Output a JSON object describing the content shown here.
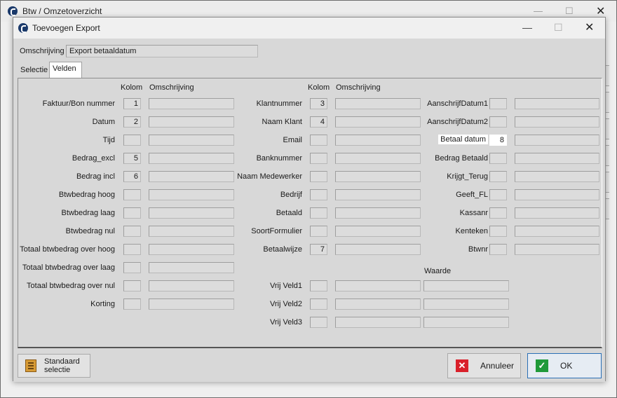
{
  "main_window": {
    "title": "Btw / Omzetoverzicht"
  },
  "dialog": {
    "title": "Toevoegen Export",
    "omschrijving_label": "Omschrijving",
    "omschrijving_value": "Export betaaldatum",
    "tabs": [
      {
        "label": "Selectie"
      },
      {
        "label": "Velden"
      }
    ],
    "col1": {
      "kolom_header": "Kolom",
      "omschrijving_header": "Omschrijving",
      "rows": [
        {
          "label": "Faktuur/Bon nummer",
          "kolom": "1",
          "omschrijving": ""
        },
        {
          "label": "Datum",
          "kolom": "2",
          "omschrijving": ""
        },
        {
          "label": "Tijd",
          "kolom": "",
          "omschrijving": ""
        },
        {
          "label": "Bedrag_excl",
          "kolom": "5",
          "omschrijving": ""
        },
        {
          "label": "Bedrag incl",
          "kolom": "6",
          "omschrijving": ""
        },
        {
          "label": "Btwbedrag hoog",
          "kolom": "",
          "omschrijving": ""
        },
        {
          "label": "Btwbedrag laag",
          "kolom": "",
          "omschrijving": ""
        },
        {
          "label": "Btwbedrag nul",
          "kolom": "",
          "omschrijving": ""
        },
        {
          "label": "Totaal btwbedrag over hoog",
          "kolom": "",
          "omschrijving": ""
        },
        {
          "label": "Totaal btwbedrag over laag",
          "kolom": "",
          "omschrijving": ""
        },
        {
          "label": "Totaal btwbedrag over nul",
          "kolom": "",
          "omschrijving": ""
        },
        {
          "label": "Korting",
          "kolom": "",
          "omschrijving": ""
        }
      ]
    },
    "col2": {
      "kolom_header": "Kolom",
      "omschrijving_header": "Omschrijving",
      "rows": [
        {
          "label": "Klantnummer",
          "kolom": "3",
          "omschrijving": ""
        },
        {
          "label": "Naam Klant",
          "kolom": "4",
          "omschrijving": ""
        },
        {
          "label": "Email",
          "kolom": "",
          "omschrijving": ""
        },
        {
          "label": "Banknummer",
          "kolom": "",
          "omschrijving": ""
        },
        {
          "label": "Naam Medewerker",
          "kolom": "",
          "omschrijving": ""
        },
        {
          "label": "Bedrijf",
          "kolom": "",
          "omschrijving": ""
        },
        {
          "label": "Betaald",
          "kolom": "",
          "omschrijving": ""
        },
        {
          "label": "SoortFormulier",
          "kolom": "",
          "omschrijving": ""
        },
        {
          "label": "Betaalwijze",
          "kolom": "7",
          "omschrijving": ""
        }
      ],
      "waarde_header": "Waarde",
      "vrij_rows": [
        {
          "label": "Vrij Veld1",
          "kolom": "",
          "omschrijving": "",
          "waarde": ""
        },
        {
          "label": "Vrij Veld2",
          "kolom": "",
          "omschrijving": "",
          "waarde": ""
        },
        {
          "label": "Vrij Veld3",
          "kolom": "",
          "omschrijving": "",
          "waarde": ""
        }
      ]
    },
    "col3": {
      "rows": [
        {
          "label": "AanschrijfDatum1",
          "kolom": "",
          "omschrijving": ""
        },
        {
          "label": "AanschrijfDatum2",
          "kolom": "",
          "omschrijving": ""
        },
        {
          "label": "Betaal datum",
          "kolom": "8",
          "omschrijving": ""
        },
        {
          "label": "Bedrag Betaald",
          "kolom": "",
          "omschrijving": ""
        },
        {
          "label": "Krijgt_Terug",
          "kolom": "",
          "omschrijving": ""
        },
        {
          "label": "Geeft_FL",
          "kolom": "",
          "omschrijving": ""
        },
        {
          "label": "Kassanr",
          "kolom": "",
          "omschrijving": ""
        },
        {
          "label": "Kenteken",
          "kolom": "",
          "omschrijving": ""
        },
        {
          "label": "Btwnr",
          "kolom": "",
          "omschrijving": ""
        }
      ]
    },
    "buttons": {
      "standaard_line1": "Standaard",
      "standaard_line2": "selectie",
      "annuleer": "Annuleer",
      "ok": "OK"
    }
  }
}
